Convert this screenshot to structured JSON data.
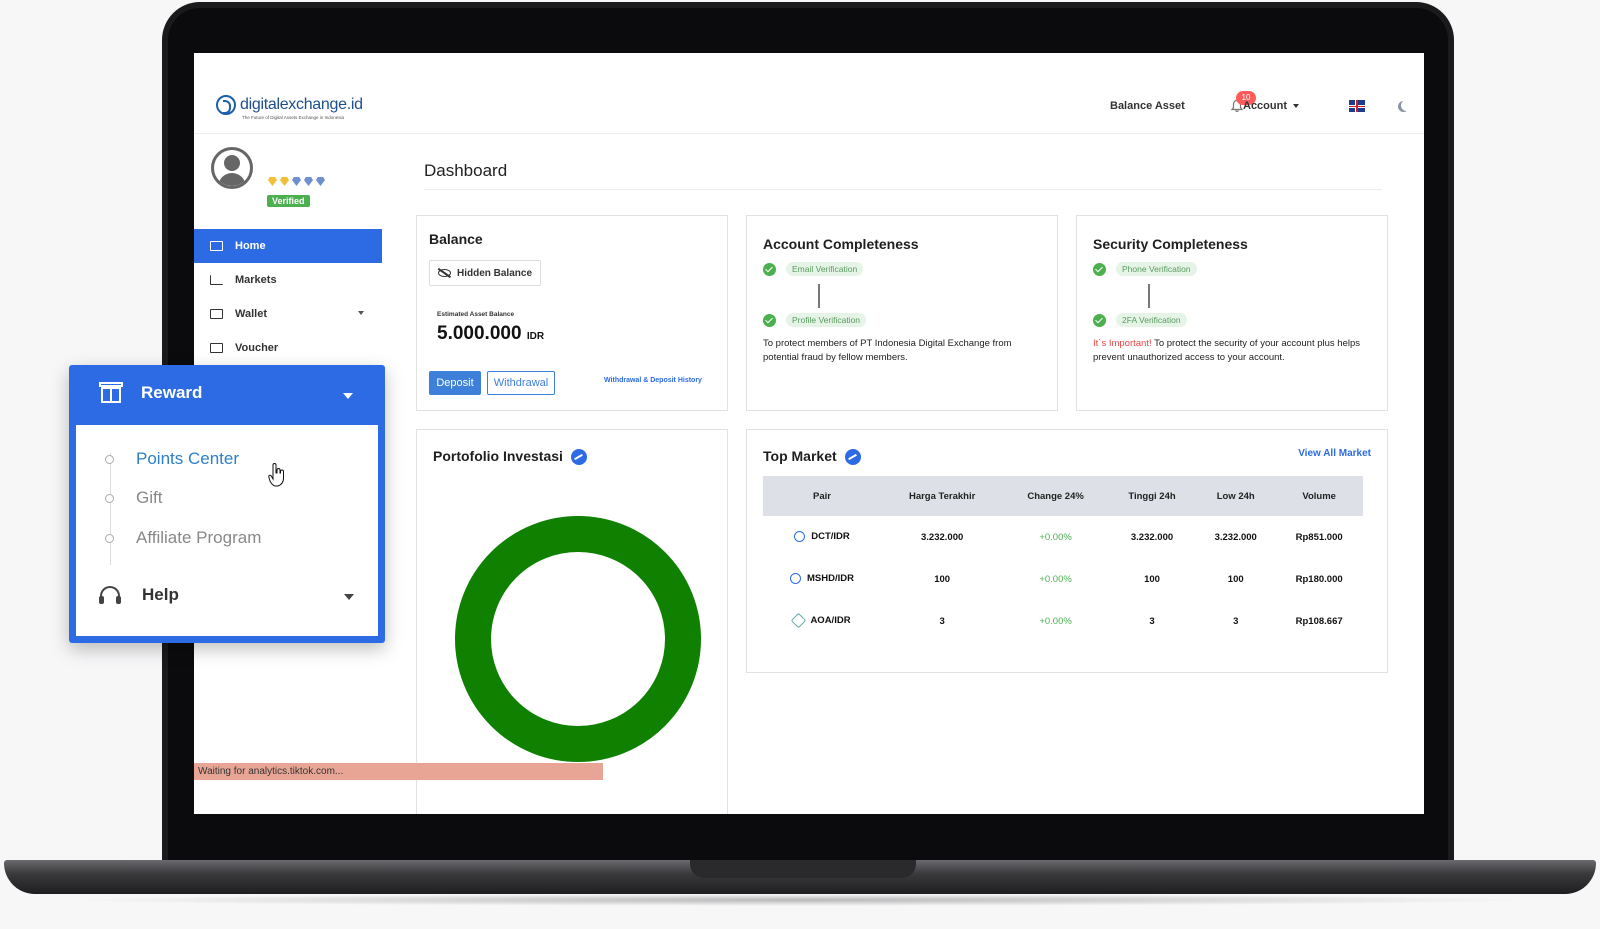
{
  "header": {
    "logo_text": "digitalexchange.id",
    "logo_tagline": "The Future of Digital Assets Exchange in Indonesia",
    "balance_asset": "Balance Asset",
    "notification_count": "10",
    "account": "Account"
  },
  "sidebar": {
    "verified": "Verified",
    "items": [
      {
        "label": "Home",
        "active": true
      },
      {
        "label": "Markets"
      },
      {
        "label": "Wallet"
      },
      {
        "label": "Voucher"
      }
    ]
  },
  "page_title": "Dashboard",
  "balance": {
    "title": "Balance",
    "hidden_balance": "Hidden Balance",
    "estimated_label": "Estimated Asset Balance",
    "value": "5.000.000",
    "currency": "IDR",
    "deposit": "Deposit",
    "withdrawal": "Withdrawal",
    "history_link": "Withdrawal & Deposit History"
  },
  "account_completeness": {
    "title": "Account Completeness",
    "step1": "Email Verification",
    "step2": "Profile Verification",
    "desc": "To protect members of PT Indonesia Digital Exchange from potential fraud by fellow members."
  },
  "security_completeness": {
    "title": "Security Completeness",
    "step1": "Phone Verification",
    "step2": "2FA Verification",
    "warn": "It`s Important!",
    "desc": " To protect the security of your account plus helps prevent unauthorized access to your account."
  },
  "portfolio": {
    "title": "Portofolio Investasi"
  },
  "top_market": {
    "title": "Top Market",
    "view_all": "View All Market",
    "columns": [
      "Pair",
      "Harga Terakhir",
      "Change 24%",
      "Tinggi 24h",
      "Low 24h",
      "Volume"
    ],
    "rows": [
      [
        "DCT/IDR",
        "3.232.000",
        "+0.00%",
        "3.232.000",
        "3.232.000",
        "Rp851.000"
      ],
      [
        "MSHD/IDR",
        "100",
        "+0.00%",
        "100",
        "100",
        "Rp180.000"
      ],
      [
        "AOA/IDR",
        "3",
        "+0.00%",
        "3",
        "3",
        "Rp108.667"
      ]
    ]
  },
  "status_bar": "Waiting for analytics.tiktok.com...",
  "popup": {
    "title": "Reward",
    "items": [
      "Points Center",
      "Gift",
      "Affiliate Program"
    ],
    "help": "Help"
  },
  "colors": {
    "primary": "#2d6be4",
    "success": "#4caf50",
    "donut": "#0f8000",
    "warning": "#e54848"
  }
}
